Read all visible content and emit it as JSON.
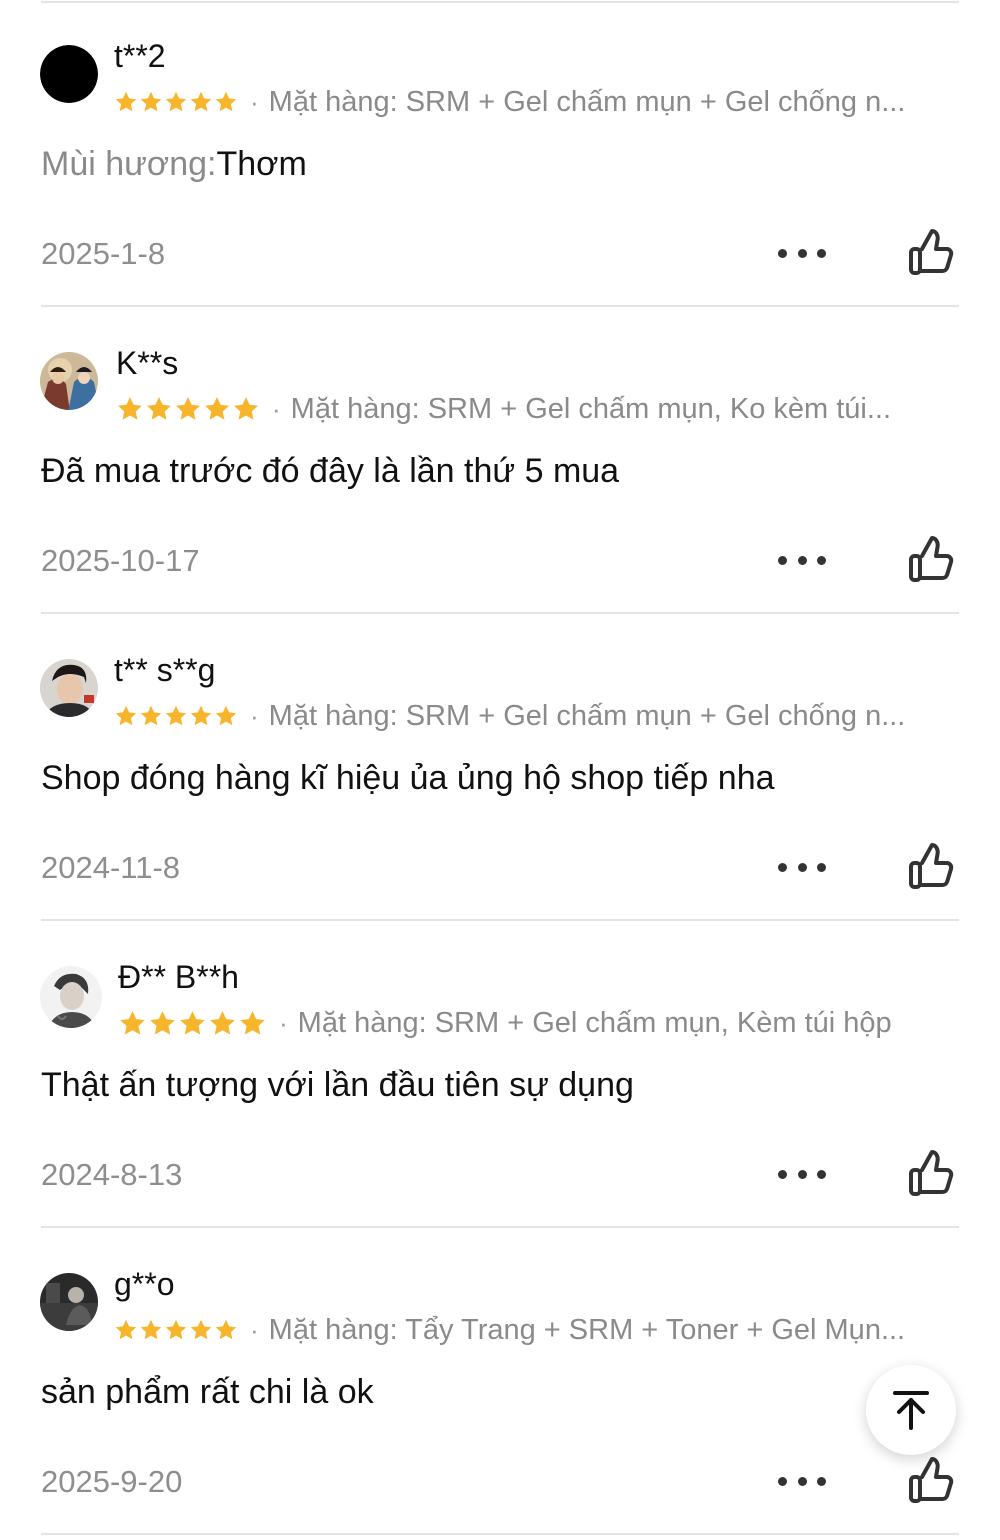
{
  "colors": {
    "star": "#f7b52c",
    "divider": "#e4e4e4",
    "muted_text": "#8a8a8a",
    "primary_text": "#111111"
  },
  "icons": {
    "rating": "star-icon",
    "more": "more-dots-icon",
    "like": "thumbs-up-icon",
    "scroll_top": "arrow-up-to-top-icon"
  },
  "reviews": [
    {
      "username": "t**2",
      "rating": 5,
      "separator": "·",
      "variant": "Mặt hàng: SRM + Gel chấm mụn + Gel chống n...",
      "comment_label": "Mùi hương:",
      "comment": "Thơm",
      "date": "2025-1-8"
    },
    {
      "username": "K**s",
      "rating": 5,
      "separator": "·",
      "variant": "Mặt hàng: SRM + Gel chấm mụn, Ko kèm túi...",
      "comment": "Đã mua trước đó đây là lần thứ 5 mua",
      "date": "2025-10-17"
    },
    {
      "username": "t** s**g",
      "rating": 5,
      "separator": "·",
      "variant": "Mặt hàng: SRM + Gel chấm mụn + Gel chống n...",
      "comment": "Shop đóng hàng kĩ hiệu ủa ủng hộ shop tiếp nha",
      "date": "2024-11-8"
    },
    {
      "username": "Đ** B**h",
      "rating": 5,
      "separator": "·",
      "variant": "Mặt hàng: SRM + Gel chấm mụn, Kèm túi hộp",
      "comment": "Thật ấn tượng với lần đầu tiên sự dụng",
      "date": "2024-8-13"
    },
    {
      "username": "g**o",
      "rating": 5,
      "separator": "·",
      "variant": "Mặt hàng: Tẩy Trang + SRM + Toner + Gel Mụn...",
      "comment": "sản phẩm rất chi là ok",
      "date": "2025-9-20"
    }
  ]
}
